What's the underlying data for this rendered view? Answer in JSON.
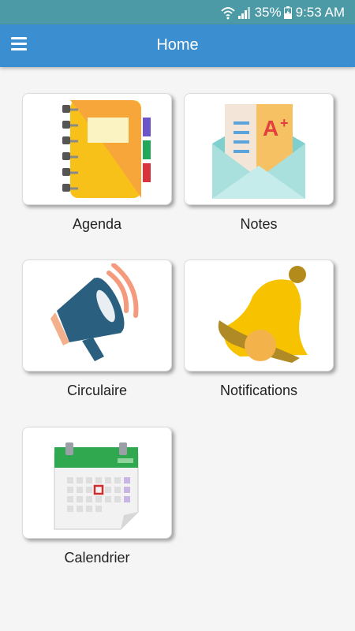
{
  "status_bar": {
    "battery": "35%",
    "time": "9:53 AM",
    "icons": [
      "wifi-icon",
      "signal-icon",
      "battery-charging-icon"
    ]
  },
  "app_bar": {
    "title": "Home",
    "menu_icon": "hamburger-menu-icon"
  },
  "tiles": [
    {
      "label": "Agenda",
      "icon": "agenda-notebook-icon"
    },
    {
      "label": "Notes",
      "icon": "notes-envelope-icon"
    },
    {
      "label": "Circulaire",
      "icon": "megaphone-icon"
    },
    {
      "label": "Notifications",
      "icon": "bell-icon"
    },
    {
      "label": "Calendrier",
      "icon": "calendar-icon"
    }
  ],
  "colors": {
    "status_bar": "#4c9aa6",
    "app_bar": "#3b8ed0",
    "background": "#f5f5f5"
  }
}
